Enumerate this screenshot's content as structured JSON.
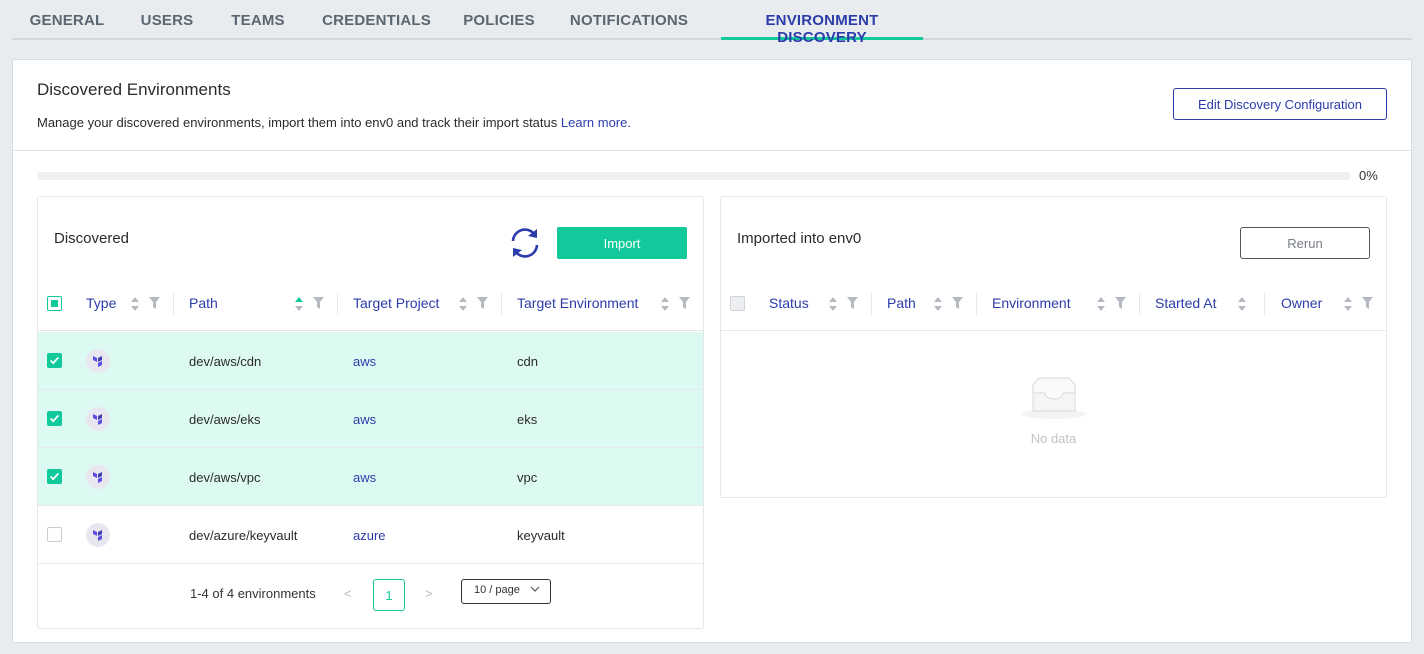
{
  "tabs": [
    {
      "label": "GENERAL",
      "active": false
    },
    {
      "label": "USERS",
      "active": false
    },
    {
      "label": "TEAMS",
      "active": false
    },
    {
      "label": "CREDENTIALS",
      "active": false
    },
    {
      "label": "POLICIES",
      "active": false
    },
    {
      "label": "NOTIFICATIONS",
      "active": false
    },
    {
      "label": "ENVIRONMENT DISCOVERY",
      "active": true
    }
  ],
  "header": {
    "title": "Discovered Environments",
    "description": "Manage your discovered environments, import them into env0 and track their import status",
    "learn_more": "Learn more.",
    "edit_button": "Edit Discovery Configuration"
  },
  "progress": {
    "value": 0,
    "label": "0%"
  },
  "discovered": {
    "title": "Discovered",
    "import_button": "Import",
    "columns": [
      "Type",
      "Path",
      "Target Project",
      "Target Environment"
    ],
    "rows": [
      {
        "type": "terraform-icon",
        "path": "dev/aws/cdn",
        "project": "aws",
        "environment": "cdn",
        "selected": true
      },
      {
        "type": "terraform-icon",
        "path": "dev/aws/eks",
        "project": "aws",
        "environment": "eks",
        "selected": true
      },
      {
        "type": "terraform-icon",
        "path": "dev/aws/vpc",
        "project": "aws",
        "environment": "vpc",
        "selected": true
      },
      {
        "type": "terraform-icon",
        "path": "dev/azure/keyvault",
        "project": "azure",
        "environment": "keyvault",
        "selected": false
      }
    ],
    "pagination": {
      "total": "1-4 of 4 environments",
      "current_page": "1",
      "page_size": "10 / page",
      "prev": "<",
      "next": ">"
    }
  },
  "imported": {
    "title": "Imported into env0",
    "rerun_button": "Rerun",
    "columns": [
      "Status",
      "Path",
      "Environment",
      "Started At",
      "Owner"
    ],
    "empty_text": "No data"
  },
  "colors": {
    "accent": "#12c99b",
    "primary": "#2b3cab",
    "selected_row": "#ddfaf2"
  }
}
